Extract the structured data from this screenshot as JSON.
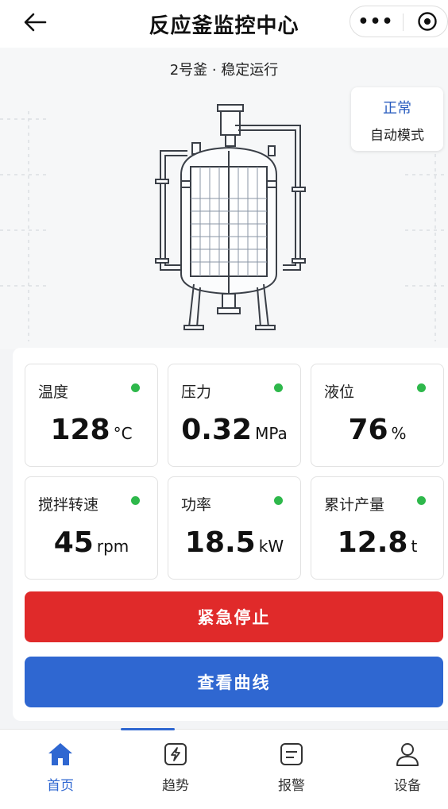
{
  "header": {
    "title": "反应釜监控中心",
    "more": "•••"
  },
  "hero": {
    "subtitle": "2号釜 · 稳定运行",
    "status": "正常",
    "mode": "自动模式"
  },
  "metrics": [
    {
      "label": "温度",
      "value": "128",
      "unit": "°C",
      "dot": "#2eb84b"
    },
    {
      "label": "压力",
      "value": "0.32",
      "unit": "MPa",
      "dot": "#2eb84b"
    },
    {
      "label": "液位",
      "value": "76",
      "unit": "%",
      "dot": "#2eb84b"
    },
    {
      "label": "搅拌转速",
      "value": "45",
      "unit": "rpm",
      "dot": "#2eb84b"
    },
    {
      "label": "功率",
      "value": "18.5",
      "unit": "kW",
      "dot": "#2eb84b"
    },
    {
      "label": "累计产量",
      "value": "12.8",
      "unit": "t",
      "dot": "#2eb84b"
    }
  ],
  "actions": {
    "stop": "紧急停止",
    "curve": "查看曲线"
  },
  "tabs": [
    {
      "label": "首页",
      "icon": "home-icon",
      "active": true
    },
    {
      "label": "趋势",
      "icon": "trend-icon",
      "active": false
    },
    {
      "label": "报警",
      "icon": "alarm-icon",
      "active": false
    },
    {
      "label": "设备",
      "icon": "device-icon",
      "active": false
    }
  ],
  "colors": {
    "accent": "#2f67d1",
    "danger": "#e02a2a",
    "ok": "#2eb84b",
    "status_text": "#2a5dbf"
  }
}
